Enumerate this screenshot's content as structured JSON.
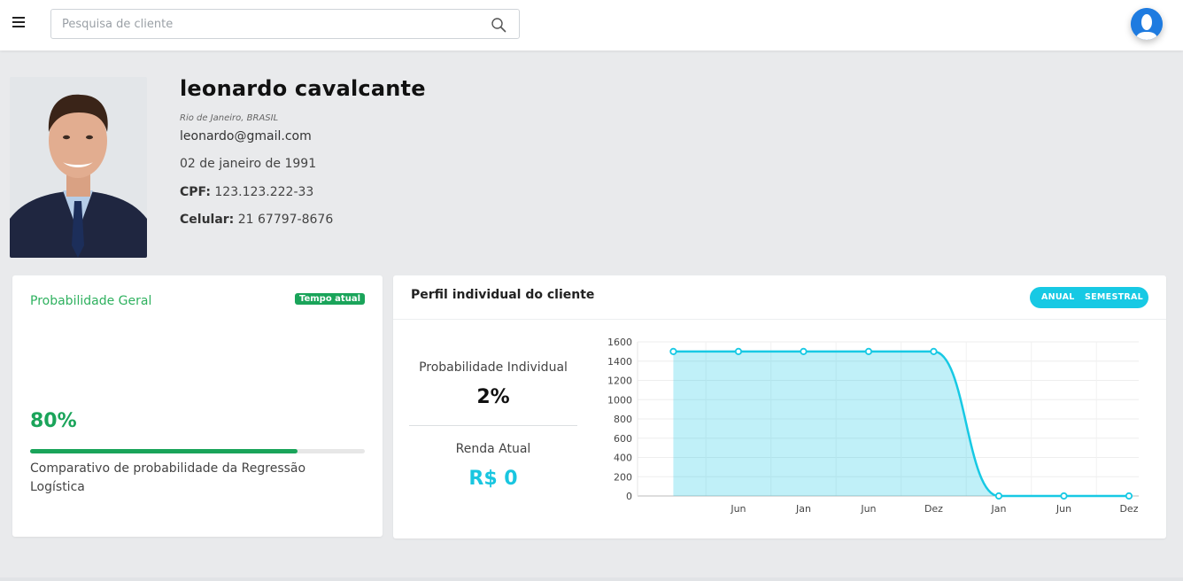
{
  "search": {
    "placeholder": "Pesquisa de cliente"
  },
  "profile": {
    "name": "leonardo cavalcante",
    "location": "Rio de Janeiro, BRASIL",
    "email": "leonardo@gmail.com",
    "birthdate": "02 de janeiro de 1991",
    "cpf_label": "CPF:",
    "cpf_value": "123.123.222-33",
    "phone_label": "Celular:",
    "phone_value": "21 67797-8676"
  },
  "general_card": {
    "title": "Probabilidade Geral",
    "badge": "Tempo atual",
    "percent_text": "80%",
    "progress": 0.8,
    "description": "Comparativo de probabilidade da Regressão Logística"
  },
  "profile_card": {
    "title": "Perfil individual do cliente",
    "toggle": [
      "ANUAL",
      "SEMESTRAL"
    ],
    "individual_label": "Probabilidade Individual",
    "individual_value": "2%",
    "income_label": "Renda Atual",
    "income_value": "R$ 0"
  },
  "colors": {
    "accent": "#17c9e4",
    "success": "#1aa45a",
    "brand": "#1e7be0"
  },
  "icons": {
    "menu": "menu-icon",
    "search": "search-icon",
    "user": "user-icon"
  },
  "chart_data": {
    "type": "area",
    "x": [
      "",
      "Jun",
      "Jan",
      "Jun",
      "Dez",
      "Jan",
      "Jun",
      "Dez"
    ],
    "series": [
      {
        "values": [
          1500,
          1500,
          1500,
          1500,
          1500,
          0,
          0,
          0
        ]
      }
    ],
    "yticks": [
      0,
      200,
      400,
      600,
      800,
      1000,
      1200,
      1400,
      1600
    ],
    "ylim": [
      0,
      1600
    ],
    "grid": true,
    "color": "#17c9e4"
  }
}
